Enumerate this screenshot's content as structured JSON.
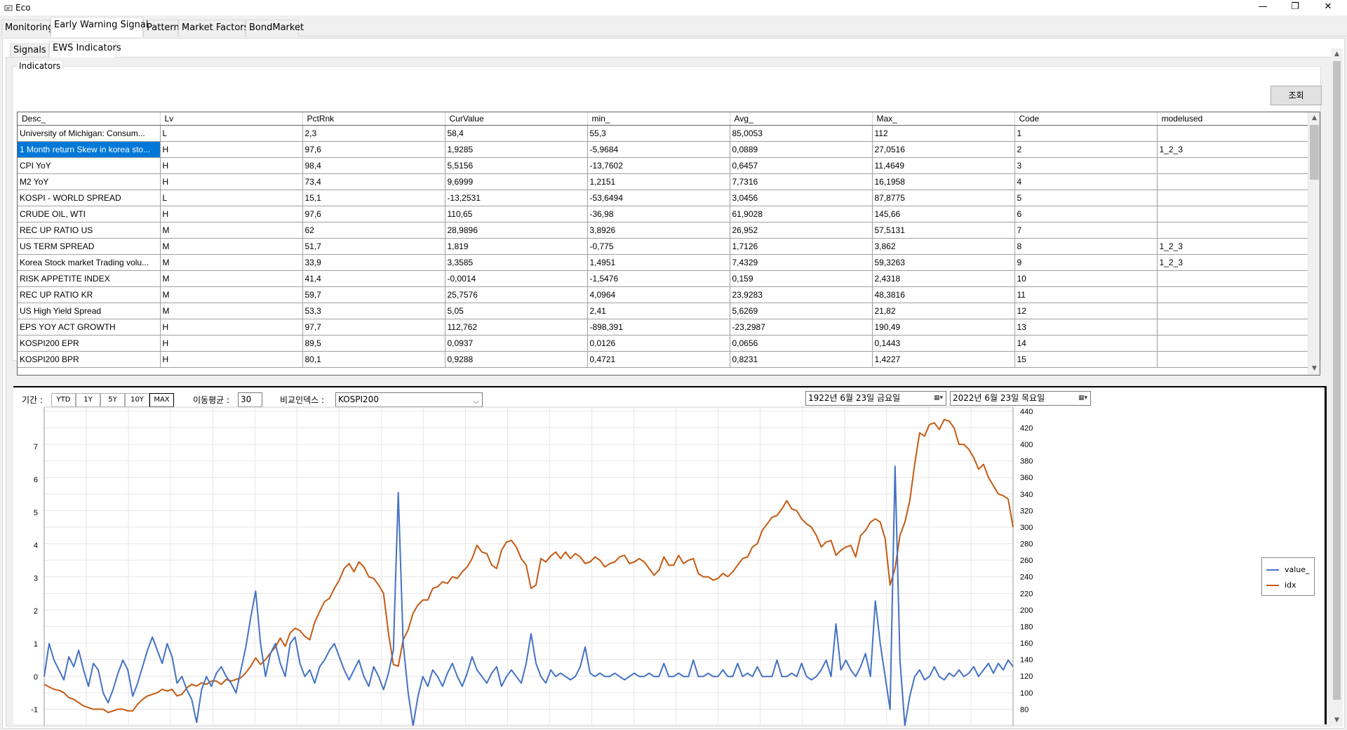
{
  "window": {
    "title": "Eco",
    "icon": "app-icon",
    "buttons": {
      "minimize": "—",
      "restore": "❐",
      "close": "✕"
    }
  },
  "main_tabs": [
    {
      "label": "Monitoring"
    },
    {
      "label": "Early Warning Signal"
    },
    {
      "label": "Pattern"
    },
    {
      "label": "Market Factors"
    },
    {
      "label": "BondMarket"
    }
  ],
  "active_main_tab": "Early Warning Signal",
  "sub_tabs": [
    {
      "label": "Signals"
    },
    {
      "label": "EWS Indicators"
    }
  ],
  "active_sub_tab": "EWS Indicators",
  "indicators": {
    "group_label": "Indicators",
    "query_button": "조회",
    "columns": [
      "Desc_",
      "Lv",
      "PctRnk",
      "CurValue",
      "min_",
      "Avg_",
      "Max_",
      "Code",
      "modelused"
    ],
    "rows": [
      [
        "University of Michigan: Consum...",
        "L",
        "2,3",
        "58,4",
        "55,3",
        "85,0053",
        "112",
        "1",
        ""
      ],
      [
        "1 Month return Skew in korea sto...",
        "H",
        "97,6",
        "1,9285",
        "-5,9684",
        "0,0889",
        "27,0516",
        "2",
        "1_2_3"
      ],
      [
        "CPI YoY",
        "H",
        "98,4",
        "5,5156",
        "-13,7602",
        "0,6457",
        "11,4649",
        "3",
        ""
      ],
      [
        "M2 YoY",
        "H",
        "73,4",
        "9,6999",
        "1,2151",
        "7,7316",
        "16,1958",
        "4",
        ""
      ],
      [
        "KOSPI - WORLD SPREAD",
        "L",
        "15,1",
        "-13,2531",
        "-53,6494",
        "3,0456",
        "87,8775",
        "5",
        ""
      ],
      [
        "CRUDE OIL, WTI",
        "H",
        "97,6",
        "110,65",
        "-36,98",
        "61,9028",
        "145,66",
        "6",
        ""
      ],
      [
        "REC UP RATIO US",
        "M",
        "62",
        "28,9896",
        "3,8926",
        "26,952",
        "57,5131",
        "7",
        ""
      ],
      [
        "US TERM SPREAD",
        "M",
        "51,7",
        "1,819",
        "-0,775",
        "1,7126",
        "3,862",
        "8",
        "1_2_3"
      ],
      [
        "Korea Stock market Trading volu...",
        "M",
        "33,9",
        "3,3585",
        "1,4951",
        "7,4329",
        "59,3263",
        "9",
        "1_2_3"
      ],
      [
        "RISK APPETITE INDEX",
        "M",
        "41,4",
        "-0,0014",
        "-1,5476",
        "0,159",
        "2,4318",
        "10",
        ""
      ],
      [
        "REC UP RATIO KR",
        "M",
        "59,7",
        "25,7576",
        "4,0964",
        "23,9283",
        "48,3816",
        "11",
        ""
      ],
      [
        "US High Yield Spread",
        "M",
        "53,3",
        "5,05",
        "2,41",
        "5,6269",
        "21,82",
        "12",
        ""
      ],
      [
        "EPS YOY ACT GROWTH",
        "H",
        "97,7",
        "112,762",
        "-898,391",
        "-23,2987",
        "190,49",
        "13",
        ""
      ],
      [
        "KOSPI200 EPR",
        "H",
        "89,5",
        "0,0937",
        "0,0126",
        "0,0656",
        "0,1443",
        "14",
        ""
      ],
      [
        "KOSPI200 BPR",
        "H",
        "80,1",
        "0,9288",
        "0,4721",
        "0,8231",
        "1,4227",
        "15",
        ""
      ]
    ],
    "selected_row": 1
  },
  "controls": {
    "period_label": "기간 :",
    "periods": [
      "YTD",
      "1Y",
      "5Y",
      "10Y",
      "MAX"
    ],
    "active_period": "MAX",
    "ma_label": "이동평균 :",
    "ma_value": "30",
    "index_label": "비교인덱스 :",
    "index_value": "KOSPI200",
    "date_from": "1922년   6월 23일 금요일",
    "date_to": "2022년   6월 23일 목요일"
  },
  "chart_data": {
    "type": "line",
    "title": "",
    "xlabel": "",
    "ylabel": "",
    "y_left": {
      "range": [
        -1.5,
        8.2
      ],
      "ticks": [
        -1,
        0,
        1,
        2,
        3,
        4,
        5,
        6,
        7
      ]
    },
    "y_right": {
      "range": [
        60,
        445
      ],
      "ticks": [
        80,
        100,
        120,
        140,
        160,
        180,
        200,
        220,
        240,
        260,
        280,
        300,
        320,
        340,
        360,
        380,
        400,
        420,
        440
      ]
    },
    "grid": true,
    "legend_position": "right",
    "series": [
      {
        "name": "value_",
        "axis": "left",
        "color": "#4472c4",
        "values": [
          0.0,
          1.0,
          0.5,
          0.2,
          -0.1,
          0.6,
          0.3,
          0.8,
          0.2,
          -0.3,
          0.4,
          0.2,
          -0.5,
          -0.8,
          -0.4,
          0.1,
          0.5,
          0.2,
          -0.6,
          -0.2,
          0.3,
          0.8,
          1.2,
          0.8,
          0.4,
          1.0,
          0.6,
          -0.2,
          0.0,
          -0.4,
          -0.7,
          -1.4,
          -0.4,
          0.0,
          -0.3,
          0.1,
          0.3,
          0.0,
          -0.2,
          -0.5,
          0.2,
          0.9,
          1.8,
          2.6,
          1.0,
          0.0,
          0.7,
          1.0,
          0.4,
          0.0,
          1.0,
          1.2,
          0.4,
          0.0,
          0.2,
          -0.2,
          0.3,
          0.5,
          0.8,
          1.0,
          0.6,
          0.2,
          -0.1,
          0.2,
          0.5,
          0.0,
          -0.3,
          0.3,
          0.0,
          -0.4,
          0.1,
          0.8,
          5.6,
          1.0,
          -0.5,
          -1.5,
          -0.6,
          0.0,
          -0.3,
          0.2,
          0.0,
          -0.3,
          0.1,
          0.4,
          0.0,
          -0.3,
          0.1,
          0.6,
          0.2,
          0.0,
          -0.2,
          0.1,
          0.3,
          -0.3,
          0.0,
          0.2,
          0.0,
          -0.2,
          0.4,
          1.3,
          0.4,
          0.0,
          -0.2,
          0.2,
          0.0,
          0.1,
          0.0,
          -0.1,
          0.0,
          0.3,
          0.9,
          0.1,
          0.0,
          0.1,
          0.0,
          0.0,
          0.1,
          0.0,
          -0.1,
          0.0,
          0.1,
          0.0,
          0.0,
          0.1,
          0.0,
          0.0,
          0.4,
          0.0,
          0.0,
          0.1,
          0.0,
          0.0,
          0.5,
          0.0,
          0.0,
          0.1,
          0.0,
          0.0,
          0.2,
          0.0,
          0.0,
          0.4,
          0.0,
          0.1,
          0.0,
          0.3,
          0.0,
          0.0,
          0.0,
          0.5,
          0.0,
          0.0,
          0.1,
          0.0,
          0.4,
          0.0,
          -0.1,
          0.0,
          0.2,
          0.5,
          0.0,
          1.6,
          0.2,
          0.5,
          0.2,
          0.0,
          0.3,
          0.7,
          0.0,
          2.3,
          1.0,
          0.0,
          -1.0,
          6.4,
          0.5,
          -1.5,
          -0.6,
          0.0,
          0.2,
          -0.1,
          0.0,
          0.3,
          0.0,
          -0.1,
          0.1,
          0.0,
          0.2,
          0.0,
          0.1,
          0.3,
          0.0,
          0.2,
          0.4,
          0.1,
          0.4,
          0.2,
          0.5,
          0.3
        ]
      },
      {
        "name": "idx",
        "axis": "right",
        "color": "#c55a11",
        "values": [
          110,
          107,
          104,
          103,
          100,
          94,
          92,
          88,
          84,
          82,
          80,
          80,
          80,
          76,
          78,
          80,
          80,
          78,
          78,
          86,
          92,
          96,
          98,
          100,
          104,
          102,
          104,
          96,
          98,
          106,
          110,
          108,
          112,
          110,
          114,
          114,
          110,
          116,
          114,
          116,
          118,
          124,
          132,
          142,
          134,
          140,
          148,
          155,
          166,
          156,
          172,
          178,
          175,
          168,
          164,
          185,
          198,
          210,
          214,
          226,
          236,
          250,
          256,
          246,
          258,
          252,
          240,
          238,
          230,
          220,
          172,
          134,
          132,
          164,
          176,
          196,
          206,
          212,
          212,
          226,
          228,
          234,
          232,
          240,
          238,
          246,
          252,
          262,
          278,
          270,
          268,
          254,
          250,
          272,
          282,
          284,
          276,
          262,
          254,
          226,
          230,
          262,
          258,
          265,
          270,
          262,
          270,
          262,
          268,
          264,
          256,
          258,
          264,
          260,
          252,
          256,
          258,
          264,
          266,
          256,
          258,
          262,
          258,
          250,
          242,
          248,
          264,
          254,
          254,
          266,
          256,
          260,
          262,
          244,
          240,
          240,
          236,
          238,
          244,
          240,
          246,
          254,
          262,
          264,
          276,
          280,
          296,
          304,
          312,
          314,
          322,
          332,
          322,
          320,
          310,
          304,
          300,
          290,
          276,
          282,
          284,
          266,
          272,
          276,
          278,
          264,
          290,
          296,
          306,
          310,
          306,
          286,
          230,
          250,
          290,
          306,
          332,
          376,
          414,
          410,
          424,
          426,
          418,
          430,
          428,
          420,
          400,
          400,
          394,
          384,
          370,
          376,
          360,
          350,
          340,
          338,
          334,
          300
        ]
      }
    ]
  },
  "legend": [
    {
      "name": "value_",
      "color": "#4472c4"
    },
    {
      "name": "idx",
      "color": "#c55a11"
    }
  ]
}
